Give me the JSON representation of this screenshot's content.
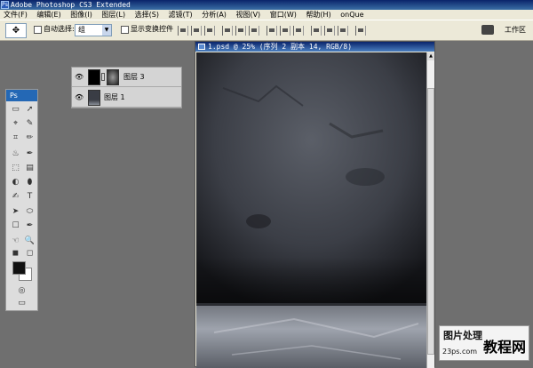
{
  "app": {
    "title": "Adobe Photoshop CS3 Extended",
    "icon": "Ps"
  },
  "menu": [
    "文件(F)",
    "编辑(E)",
    "图像(I)",
    "图层(L)",
    "选择(S)",
    "滤镜(T)",
    "分析(A)",
    "视图(V)",
    "窗口(W)",
    "帮助(H)",
    "onQue"
  ],
  "options": {
    "auto_select_label": "自动选择:",
    "auto_select_value": "组",
    "show_transform_label": "显示变换控件",
    "workspace_label": "工作区"
  },
  "layers": [
    {
      "name": "图层 3",
      "eye": "👁"
    },
    {
      "name": "图层 1",
      "eye": "👁"
    }
  ],
  "toolbox": {
    "header": "Ps",
    "tools": [
      "▭",
      "➚",
      "⌖",
      "✎",
      "⌗",
      "✏",
      "♨",
      "✒",
      "⬚",
      "▤",
      "◐",
      "⬮",
      "✍",
      "T",
      "➤",
      "⬭",
      "☐",
      "✒",
      "☜",
      "🔍",
      "◼",
      "◻",
      "⧉"
    ]
  },
  "document": {
    "title": "1.psd @ 25% (序列 2 副本 14, RGB/8)"
  },
  "watermark": {
    "title": "图片处理",
    "big": "教程网",
    "url": "23ps.com"
  }
}
